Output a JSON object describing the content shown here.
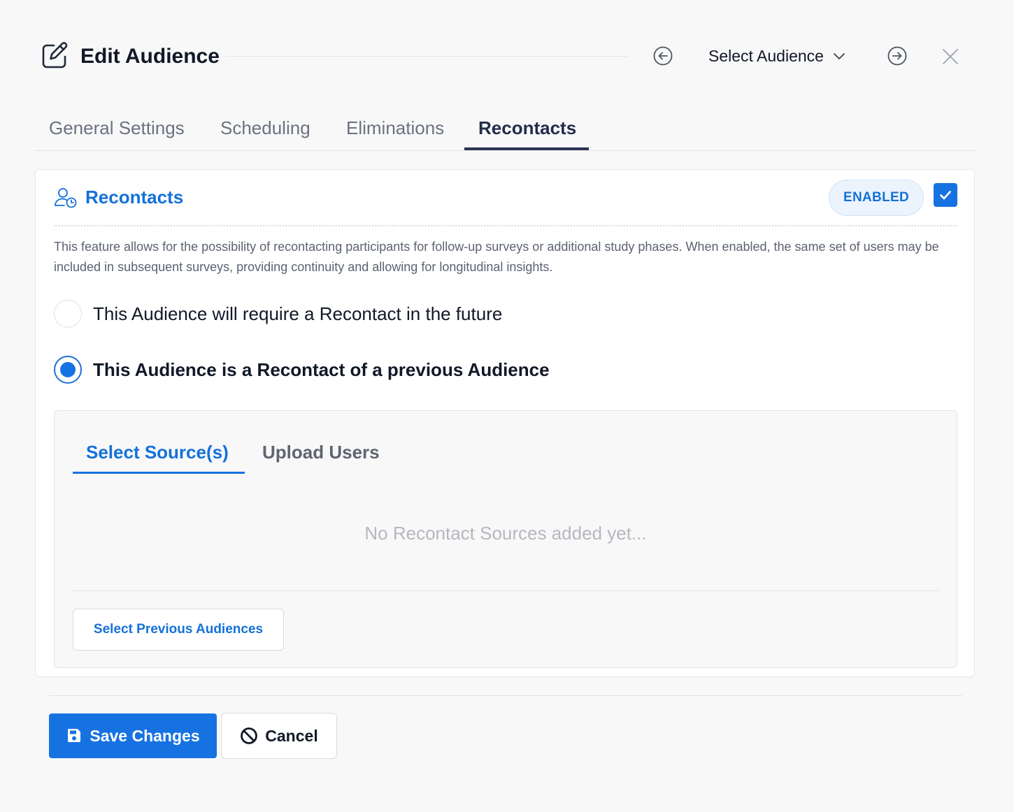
{
  "header": {
    "title": "Edit Audience",
    "audience_select_label": "Select Audience",
    "icons": {
      "edit": "edit-square-icon",
      "prev": "arrow-left-circle-icon",
      "next": "arrow-right-circle-icon",
      "dropdown": "chevron-down-icon",
      "close": "close-icon"
    }
  },
  "tabs": [
    {
      "label": "General Settings",
      "active": false
    },
    {
      "label": "Scheduling",
      "active": false
    },
    {
      "label": "Eliminations",
      "active": false
    },
    {
      "label": "Recontacts",
      "active": true
    }
  ],
  "recontacts": {
    "title": "Recontacts",
    "title_icon": "user-clock-icon",
    "status_badge": "ENABLED",
    "enabled": true,
    "description": "This feature allows for the possibility of recontacting participants for follow-up surveys or additional study phases. When enabled, the same set of users may be included in subsequent surveys, providing continuity and allowing for longitudinal insights.",
    "options": [
      {
        "label": "This Audience will require a Recontact in the future",
        "selected": false
      },
      {
        "label": "This Audience is a Recontact of a previous Audience",
        "selected": true
      }
    ],
    "source_panel": {
      "tabs": [
        {
          "label": "Select Source(s)",
          "active": true
        },
        {
          "label": "Upload Users",
          "active": false
        }
      ],
      "empty_message": "No Recontact Sources added yet...",
      "select_button": "Select Previous Audiences"
    }
  },
  "footer": {
    "save_label": "Save Changes",
    "save_icon": "floppy-disk-icon",
    "cancel_label": "Cancel",
    "cancel_icon": "ban-icon"
  },
  "colors": {
    "accent": "#1672e1",
    "accent_text": "#1471d9",
    "tab_active": "#232c4c",
    "muted": "#6b7280",
    "background": "#f8f8f9"
  }
}
